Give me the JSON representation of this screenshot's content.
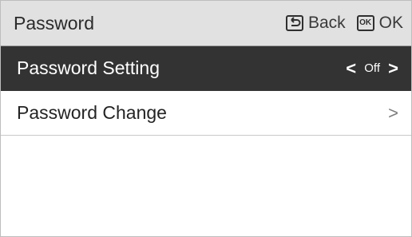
{
  "header": {
    "title": "Password",
    "back_label": "Back",
    "ok_icon_text": "OK",
    "ok_label": "OK"
  },
  "items": [
    {
      "label": "Password Setting",
      "value": "Off",
      "left_chevron": "<",
      "right_chevron": ">"
    },
    {
      "label": "Password Change",
      "right_chevron": ">"
    }
  ],
  "colors": {
    "header_bg": "#e1e1e1",
    "selected_bg": "#333333",
    "text_dark": "#242424",
    "text_light": "#ffffff"
  },
  "icons": {
    "back": "back-icon",
    "ok": "ok-key-icon",
    "left": "chevron-left-icon",
    "right": "chevron-right-icon"
  }
}
